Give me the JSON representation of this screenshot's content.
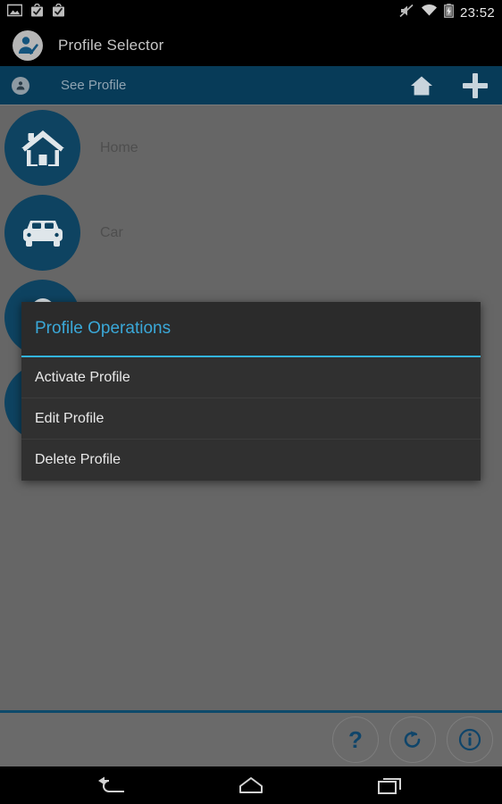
{
  "status_bar": {
    "time": "23:52",
    "left_icons": [
      "image-icon",
      "install-complete-icon",
      "install-complete-icon"
    ],
    "right_icons": [
      "volume-muted-icon",
      "wifi-icon",
      "battery-charging-icon"
    ]
  },
  "title_bar": {
    "app_icon": "profile-person-check-icon",
    "title": "Profile Selector"
  },
  "action_bar": {
    "left_icon": "person-icon",
    "label": "See Profile",
    "home_icon": "home-icon",
    "add_icon": "plus-icon",
    "background_color": "#073b58"
  },
  "profiles": [
    {
      "label": "Home",
      "icon": "house-icon"
    },
    {
      "label": "Car",
      "icon": "car-icon"
    },
    {
      "label": "",
      "icon": "lock-icon"
    },
    {
      "label": "",
      "icon": "person-icon"
    }
  ],
  "dialog": {
    "title": "Profile Operations",
    "accent_color": "#33b5e5",
    "items": [
      {
        "label": "Activate Profile"
      },
      {
        "label": "Edit Profile"
      },
      {
        "label": "Delete Profile"
      }
    ]
  },
  "bottom_bar": {
    "buttons": [
      {
        "label": "?",
        "name": "help-button"
      },
      {
        "label": "↻",
        "name": "refresh-button"
      },
      {
        "label": "ⓘ",
        "name": "info-button"
      }
    ],
    "accent_color": "#0d4a6b"
  },
  "nav_bar": {
    "back": "back-icon",
    "home": "home-icon",
    "recents": "recents-icon"
  },
  "colors": {
    "profile_circle": "#0e4361",
    "dim_overlay": "#666666",
    "dialog_bg": "#303030"
  }
}
